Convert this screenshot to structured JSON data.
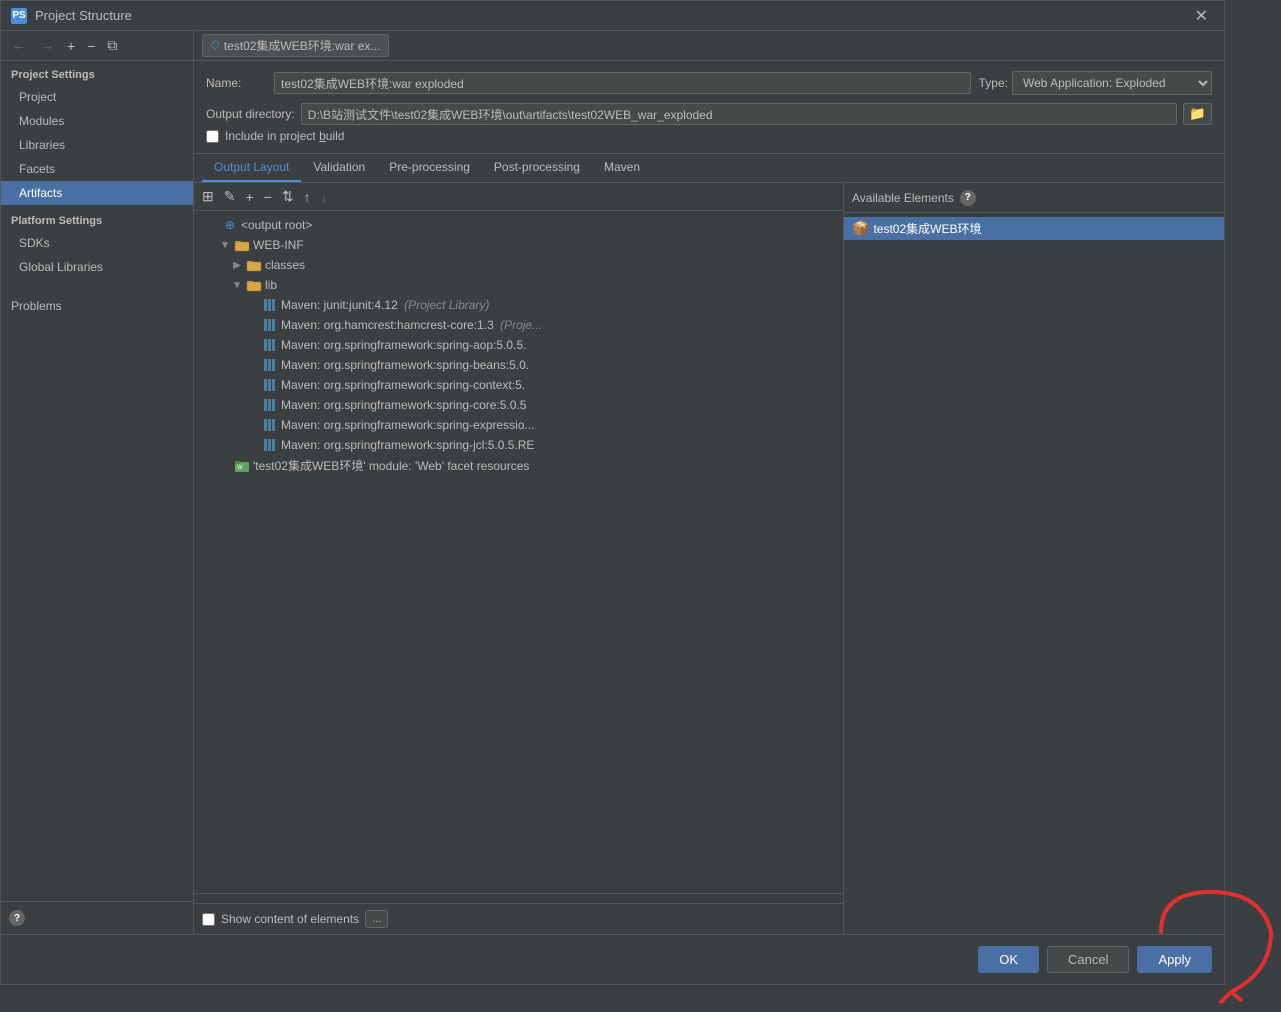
{
  "dialog": {
    "title": "Project Structure",
    "title_icon": "PS"
  },
  "sidebar": {
    "nav_back_disabled": true,
    "nav_forward_disabled": true,
    "project_settings_label": "Project Settings",
    "items": [
      {
        "id": "project",
        "label": "Project"
      },
      {
        "id": "modules",
        "label": "Modules"
      },
      {
        "id": "libraries",
        "label": "Libraries"
      },
      {
        "id": "facets",
        "label": "Facets"
      },
      {
        "id": "artifacts",
        "label": "Artifacts",
        "active": true
      }
    ],
    "platform_settings_label": "Platform Settings",
    "platform_items": [
      {
        "id": "sdks",
        "label": "SDKs"
      },
      {
        "id": "global-libraries",
        "label": "Global Libraries"
      }
    ],
    "problems_label": "Problems"
  },
  "artifact": {
    "tab_icon": "war",
    "tab_label": "test02集成WEB环境:war ex...",
    "name_label": "Name:",
    "name_value": "test02集成WEB环境:war exploded",
    "type_label": "Type:",
    "type_value": "Web Application: Exploded",
    "output_directory_label": "Output directory:",
    "output_directory_value": "D:\\B站测试文件\\test02集成WEB环境\\out\\artifacts\\test02WEB_war_exploded",
    "include_project_build_label": "Include in project build",
    "include_project_build_checked": false
  },
  "tabs": [
    {
      "id": "output-layout",
      "label": "Output Layout",
      "active": true
    },
    {
      "id": "validation",
      "label": "Validation"
    },
    {
      "id": "pre-processing",
      "label": "Pre-processing"
    },
    {
      "id": "post-processing",
      "label": "Post-processing"
    },
    {
      "id": "maven",
      "label": "Maven"
    }
  ],
  "tree_toolbar": {
    "add_icon": "+",
    "remove_icon": "−",
    "options_icon": "⚙",
    "up_icon": "↑",
    "down_icon": "↓"
  },
  "tree": {
    "nodes": [
      {
        "id": "output-root",
        "level": 0,
        "arrow": "",
        "icon": "output-root",
        "text": "<output root>",
        "type": "normal"
      },
      {
        "id": "web-inf",
        "level": 1,
        "arrow": "▼",
        "icon": "folder",
        "text": "WEB-INF",
        "type": "normal"
      },
      {
        "id": "classes",
        "level": 2,
        "arrow": "▶",
        "icon": "folder",
        "text": "classes",
        "type": "normal"
      },
      {
        "id": "lib",
        "level": 2,
        "arrow": "▼",
        "icon": "folder",
        "text": "lib",
        "type": "normal"
      },
      {
        "id": "maven-junit",
        "level": 3,
        "arrow": "",
        "icon": "maven",
        "text": "Maven: junit:junit:4.12",
        "suffix": " (Project Library)",
        "type": "maven"
      },
      {
        "id": "maven-hamcrest",
        "level": 3,
        "arrow": "",
        "icon": "maven",
        "text": "Maven: org.hamcrest:hamcrest-core:1.3",
        "suffix": " (Proje...",
        "type": "maven"
      },
      {
        "id": "maven-spring-aop",
        "level": 3,
        "arrow": "",
        "icon": "maven",
        "text": "Maven: org.springframework:spring-aop:5.0.5.",
        "type": "maven"
      },
      {
        "id": "maven-spring-beans",
        "level": 3,
        "arrow": "",
        "icon": "maven",
        "text": "Maven: org.springframework:spring-beans:5.0.",
        "type": "maven"
      },
      {
        "id": "maven-spring-context",
        "level": 3,
        "arrow": "",
        "icon": "maven",
        "text": "Maven: org.springframework:spring-context:5.",
        "type": "maven"
      },
      {
        "id": "maven-spring-core",
        "level": 3,
        "arrow": "",
        "icon": "maven",
        "text": "Maven: org.springframework:spring-core:5.0.5",
        "type": "maven"
      },
      {
        "id": "maven-spring-expression",
        "level": 3,
        "arrow": "",
        "icon": "maven",
        "text": "Maven: org.springframework:spring-expressio...",
        "type": "maven"
      },
      {
        "id": "maven-spring-jcl",
        "level": 3,
        "arrow": "",
        "icon": "maven",
        "text": "Maven: org.springframework:spring-jcl:5.0.5.RE",
        "type": "maven"
      },
      {
        "id": "web-facet",
        "level": 1,
        "arrow": "",
        "icon": "web-facet",
        "text": "'test02集成WEB环境' module: 'Web' facet resources",
        "type": "facet"
      }
    ]
  },
  "elements_panel": {
    "title": "Available Elements",
    "help_icon": "?",
    "items": [
      {
        "id": "test02",
        "label": "test02集成WEB环境",
        "icon": "module",
        "selected": true
      }
    ]
  },
  "bottom": {
    "show_content_label": "Show content of elements",
    "show_content_checked": false,
    "more_label": "..."
  },
  "footer": {
    "ok_label": "OK",
    "cancel_label": "Cancel",
    "apply_label": "Apply"
  },
  "icons": {
    "close": "✕",
    "back": "←",
    "forward": "→",
    "add": "+",
    "remove": "−",
    "copy": "⧉",
    "question": "?"
  }
}
